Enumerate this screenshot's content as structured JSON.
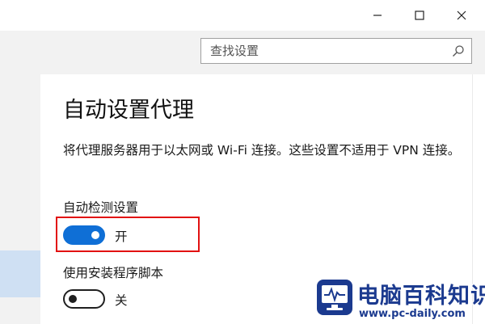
{
  "search": {
    "placeholder": "查找设置",
    "value": ""
  },
  "page": {
    "title": "自动设置代理",
    "description": "将代理服务器用于以太网或 Wi-Fi 连接。这些设置不适用于 VPN 连接。"
  },
  "settings": [
    {
      "label": "自动检测设置",
      "state": "开",
      "on": true
    },
    {
      "label": "使用安装程序脚本",
      "state": "关",
      "on": false
    }
  ],
  "watermark": {
    "title": "电脑百科知识",
    "url": "www.pc-daily.com"
  },
  "colors": {
    "accent": "#0f6fd6",
    "highlight": "#e21111",
    "sidebar_selected": "#cfe0f3",
    "watermark": "#1b3a8f"
  },
  "icons": {
    "minimize": "minimize-icon",
    "maximize": "maximize-icon",
    "close": "close-icon",
    "search": "search-icon",
    "watermark_logo": "monitor-pulse-icon"
  }
}
